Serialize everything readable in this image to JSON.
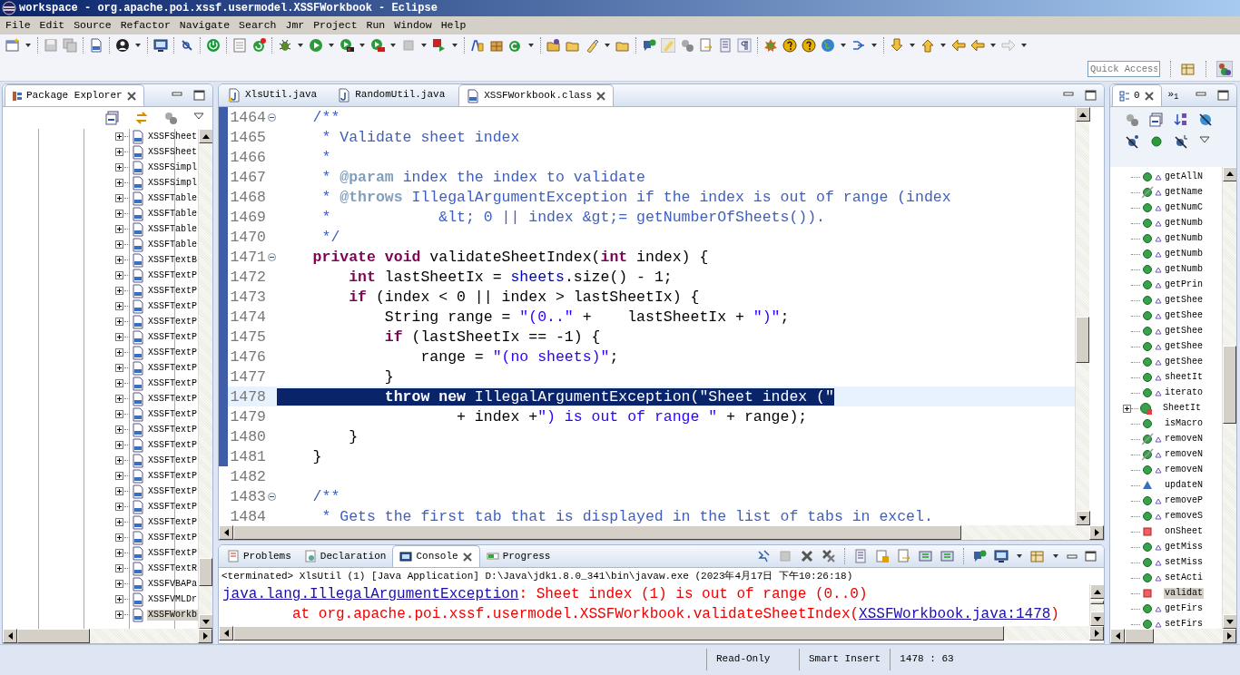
{
  "window": {
    "title": "workspace - org.apache.poi.xssf.usermodel.XSSFWorkbook - Eclipse"
  },
  "menu": [
    "File",
    "Edit",
    "Source",
    "Refactor",
    "Navigate",
    "Search",
    "Jmr",
    "Project",
    "Run",
    "Window",
    "Help"
  ],
  "quick_access": {
    "placeholder": "Quick Access"
  },
  "package_explorer": {
    "tab": {
      "label": "Package Explorer",
      "selected": true
    },
    "items": [
      {
        "label": "XSSFSheet",
        "selected": false
      },
      {
        "label": "XSSFSheet",
        "selected": false
      },
      {
        "label": "XSSFSimpl",
        "selected": false
      },
      {
        "label": "XSSFSimpl",
        "selected": false
      },
      {
        "label": "XSSFTable",
        "selected": false
      },
      {
        "label": "XSSFTable",
        "selected": false
      },
      {
        "label": "XSSFTable",
        "selected": false
      },
      {
        "label": "XSSFTable",
        "selected": false
      },
      {
        "label": "XSSFTextB",
        "selected": false
      },
      {
        "label": "XSSFTextP",
        "selected": false
      },
      {
        "label": "XSSFTextP",
        "selected": false
      },
      {
        "label": "XSSFTextP",
        "selected": false
      },
      {
        "label": "XSSFTextP",
        "selected": false
      },
      {
        "label": "XSSFTextP",
        "selected": false
      },
      {
        "label": "XSSFTextP",
        "selected": false
      },
      {
        "label": "XSSFTextP",
        "selected": false
      },
      {
        "label": "XSSFTextP",
        "selected": false
      },
      {
        "label": "XSSFTextP",
        "selected": false
      },
      {
        "label": "XSSFTextP",
        "selected": false
      },
      {
        "label": "XSSFTextP",
        "selected": false
      },
      {
        "label": "XSSFTextP",
        "selected": false
      },
      {
        "label": "XSSFTextP",
        "selected": false
      },
      {
        "label": "XSSFTextP",
        "selected": false
      },
      {
        "label": "XSSFTextP",
        "selected": false
      },
      {
        "label": "XSSFTextP",
        "selected": false
      },
      {
        "label": "XSSFTextP",
        "selected": false
      },
      {
        "label": "XSSFTextP",
        "selected": false
      },
      {
        "label": "XSSFTextP",
        "selected": false
      },
      {
        "label": "XSSFTextR",
        "selected": false
      },
      {
        "label": "XSSFVBAPa",
        "selected": false
      },
      {
        "label": "XSSFVMLDr",
        "selected": false
      },
      {
        "label": "XSSFWorkb",
        "selected": true
      }
    ]
  },
  "editor": {
    "tabs": [
      {
        "label": "XlsUtil.java",
        "kind": "java-warning",
        "selected": false
      },
      {
        "label": "RandomUtil.java",
        "kind": "java",
        "selected": false
      },
      {
        "label": "XSSFWorkbook.class",
        "kind": "class",
        "selected": true
      }
    ],
    "lines": [
      {
        "number": "1464",
        "fold": true,
        "in_range": true,
        "selected": false,
        "tokens": [
          {
            "t": "    /**",
            "kind": "doc"
          }
        ]
      },
      {
        "number": "1465",
        "fold": false,
        "in_range": true,
        "selected": false,
        "tokens": [
          {
            "t": "     * Validate sheet index",
            "kind": "doc"
          }
        ]
      },
      {
        "number": "1466",
        "fold": false,
        "in_range": true,
        "selected": false,
        "tokens": [
          {
            "t": "     *",
            "kind": "doc"
          }
        ]
      },
      {
        "number": "1467",
        "fold": false,
        "in_range": true,
        "selected": false,
        "tokens": [
          {
            "t": "     * ",
            "kind": "doc"
          },
          {
            "t": "@param",
            "kind": "tag"
          },
          {
            "t": " index the index to validate",
            "kind": "doc"
          }
        ]
      },
      {
        "number": "1468",
        "fold": false,
        "in_range": true,
        "selected": false,
        "tokens": [
          {
            "t": "     * ",
            "kind": "doc"
          },
          {
            "t": "@throws",
            "kind": "tag"
          },
          {
            "t": " IllegalArgumentException if the index is out of range (index",
            "kind": "doc"
          }
        ]
      },
      {
        "number": "1469",
        "fold": false,
        "in_range": true,
        "selected": false,
        "tokens": [
          {
            "t": "     *            &lt; 0 || index &gt;= getNumberOfSheets()).",
            "kind": "doc"
          }
        ]
      },
      {
        "number": "1470",
        "fold": false,
        "in_range": true,
        "selected": false,
        "tokens": [
          {
            "t": "     */",
            "kind": "doc"
          }
        ]
      },
      {
        "number": "1471",
        "fold": true,
        "in_range": true,
        "selected": false,
        "tokens": [
          {
            "t": "    private",
            "kind": "kw"
          },
          {
            "t": " void",
            "kind": "kw"
          },
          {
            "t": " validateSheetIndex(",
            "kind": "plain"
          },
          {
            "t": "int",
            "kind": "kw"
          },
          {
            "t": " index) {",
            "kind": "plain"
          }
        ]
      },
      {
        "number": "1472",
        "fold": false,
        "in_range": true,
        "selected": false,
        "tokens": [
          {
            "t": "        int",
            "kind": "kw"
          },
          {
            "t": " lastSheetIx = ",
            "kind": "plain"
          },
          {
            "t": "sheets",
            "kind": "field"
          },
          {
            "t": ".size() - 1;",
            "kind": "plain"
          }
        ]
      },
      {
        "number": "1473",
        "fold": false,
        "in_range": true,
        "selected": false,
        "tokens": [
          {
            "t": "        if",
            "kind": "kw"
          },
          {
            "t": " (index < 0 || index > lastSheetIx) {",
            "kind": "plain"
          }
        ]
      },
      {
        "number": "1474",
        "fold": false,
        "in_range": true,
        "selected": false,
        "tokens": [
          {
            "t": "            String range = ",
            "kind": "plain"
          },
          {
            "t": "\"(0..\"",
            "kind": "str"
          },
          {
            "t": " +    lastSheetIx + ",
            "kind": "plain"
          },
          {
            "t": "\")\"",
            "kind": "str"
          },
          {
            "t": ";",
            "kind": "plain"
          }
        ]
      },
      {
        "number": "1475",
        "fold": false,
        "in_range": true,
        "selected": false,
        "tokens": [
          {
            "t": "            if",
            "kind": "kw"
          },
          {
            "t": " (lastSheetIx == -1) {",
            "kind": "plain"
          }
        ]
      },
      {
        "number": "1476",
        "fold": false,
        "in_range": true,
        "selected": false,
        "tokens": [
          {
            "t": "                range = ",
            "kind": "plain"
          },
          {
            "t": "\"(no sheets)\"",
            "kind": "str"
          },
          {
            "t": ";",
            "kind": "plain"
          }
        ]
      },
      {
        "number": "1477",
        "fold": false,
        "in_range": true,
        "selected": false,
        "tokens": [
          {
            "t": "            }",
            "kind": "plain"
          }
        ]
      },
      {
        "number": "1478",
        "fold": false,
        "in_range": true,
        "selected": true,
        "tokens": [
          {
            "t": "            throw",
            "kind": "kw"
          },
          {
            "t": " new",
            "kind": "kw"
          },
          {
            "t": " IllegalArgumentException(",
            "kind": "plain"
          },
          {
            "t": "\"Sheet index (\"",
            "kind": "str"
          }
        ]
      },
      {
        "number": "1479",
        "fold": false,
        "in_range": true,
        "selected": false,
        "tokens": [
          {
            "t": "                    + index +",
            "kind": "plain"
          },
          {
            "t": "\") is out of range \"",
            "kind": "str"
          },
          {
            "t": " + range);",
            "kind": "plain"
          }
        ]
      },
      {
        "number": "1480",
        "fold": false,
        "in_range": true,
        "selected": false,
        "tokens": [
          {
            "t": "        }",
            "kind": "plain"
          }
        ]
      },
      {
        "number": "1481",
        "fold": false,
        "in_range": true,
        "selected": false,
        "tokens": [
          {
            "t": "    }",
            "kind": "plain"
          }
        ]
      },
      {
        "number": "1482",
        "fold": false,
        "in_range": false,
        "selected": false
      },
      {
        "number": "1483",
        "fold": true,
        "in_range": false,
        "selected": false,
        "tokens": [
          {
            "t": "    /**",
            "kind": "doc"
          }
        ]
      },
      {
        "number": "1484",
        "fold": false,
        "in_range": false,
        "selected": false,
        "tokens": [
          {
            "t": "     * Gets the first tab that is displayed in the list of tabs in excel.",
            "kind": "doc"
          }
        ]
      }
    ]
  },
  "console": {
    "tabs": [
      {
        "label": "Problems",
        "kind": "problems",
        "selected": false
      },
      {
        "label": "Declaration",
        "kind": "declaration",
        "selected": false
      },
      {
        "label": "Console",
        "kind": "console",
        "selected": true
      },
      {
        "label": "Progress",
        "kind": "progress",
        "selected": false
      }
    ],
    "header": "<terminated> XlsUtil (1) [Java Application] D:\\Java\\jdk1.8.0_341\\bin\\javaw.exe (2023年4月17日 下午10:26:18)",
    "output": [
      {
        "indent": false,
        "segments": [
          {
            "t": "java.lang.IllegalArgumentException",
            "kind": "link"
          },
          {
            "t": ": Sheet index (1) is out of range (0..0)",
            "kind": "error"
          }
        ]
      },
      {
        "indent": true,
        "segments": [
          {
            "t": "at org.apache.poi.xssf.usermodel.XSSFWorkbook.validateSheetIndex(",
            "kind": "error"
          },
          {
            "t": "XSSFWorkbook.java:1478",
            "kind": "link"
          },
          {
            "t": ")",
            "kind": "error"
          }
        ]
      }
    ]
  },
  "outline": {
    "tabs": [
      {
        "label": "0",
        "selected": true
      },
      {
        "label": "»$_{1}$",
        "selected": false
      }
    ],
    "items": [
      {
        "label": "getAllN",
        "kind": "public",
        "override": true,
        "selected": false
      },
      {
        "label": "getName",
        "kind": "public-struck",
        "override": true,
        "selected": false
      },
      {
        "label": "getNumC",
        "kind": "public",
        "override": true,
        "selected": false
      },
      {
        "label": "getNumb",
        "kind": "public",
        "override": true,
        "selected": false
      },
      {
        "label": "getNumb",
        "kind": "public",
        "override": true,
        "selected": false
      },
      {
        "label": "getNumb",
        "kind": "public",
        "override": true,
        "selected": false
      },
      {
        "label": "getNumb",
        "kind": "public",
        "override": true,
        "selected": false
      },
      {
        "label": "getPrin",
        "kind": "public",
        "override": true,
        "selected": false
      },
      {
        "label": "getShee",
        "kind": "public",
        "override": true,
        "selected": false
      },
      {
        "label": "getShee",
        "kind": "public",
        "override": true,
        "selected": false
      },
      {
        "label": "getShee",
        "kind": "public",
        "override": true,
        "selected": false
      },
      {
        "label": "getShee",
        "kind": "public",
        "override": true,
        "selected": false
      },
      {
        "label": "getShee",
        "kind": "public",
        "override": true,
        "selected": false
      },
      {
        "label": "sheetIt",
        "kind": "public",
        "override": true,
        "selected": false
      },
      {
        "label": "iterato",
        "kind": "public",
        "override": true,
        "selected": false
      },
      {
        "label": "SheetIt",
        "kind": "class",
        "override": false,
        "selected": false
      },
      {
        "label": "isMacro",
        "kind": "public",
        "override": false,
        "selected": false
      },
      {
        "label": "removeN",
        "kind": "public-struck",
        "override": true,
        "selected": false
      },
      {
        "label": "removeN",
        "kind": "public-struck",
        "override": true,
        "selected": false
      },
      {
        "label": "removeN",
        "kind": "public",
        "override": true,
        "selected": false
      },
      {
        "label": "updateN",
        "kind": "package",
        "override": false,
        "selected": false
      },
      {
        "label": "removeP",
        "kind": "public",
        "override": true,
        "selected": false
      },
      {
        "label": "removeS",
        "kind": "public",
        "override": true,
        "selected": false
      },
      {
        "label": "onSheet",
        "kind": "private",
        "override": false,
        "selected": false
      },
      {
        "label": "getMiss",
        "kind": "public",
        "override": true,
        "selected": false
      },
      {
        "label": "setMiss",
        "kind": "public",
        "override": true,
        "selected": false
      },
      {
        "label": "setActi",
        "kind": "public",
        "override": true,
        "selected": false
      },
      {
        "label": "validat",
        "kind": "private",
        "override": false,
        "selected": true
      },
      {
        "label": "getFirs",
        "kind": "public",
        "override": true,
        "selected": false
      },
      {
        "label": "setFirs",
        "kind": "public",
        "override": true,
        "selected": false
      }
    ]
  },
  "status_bar": [
    "Read-Only",
    "Smart Insert",
    "1478 : 63"
  ]
}
